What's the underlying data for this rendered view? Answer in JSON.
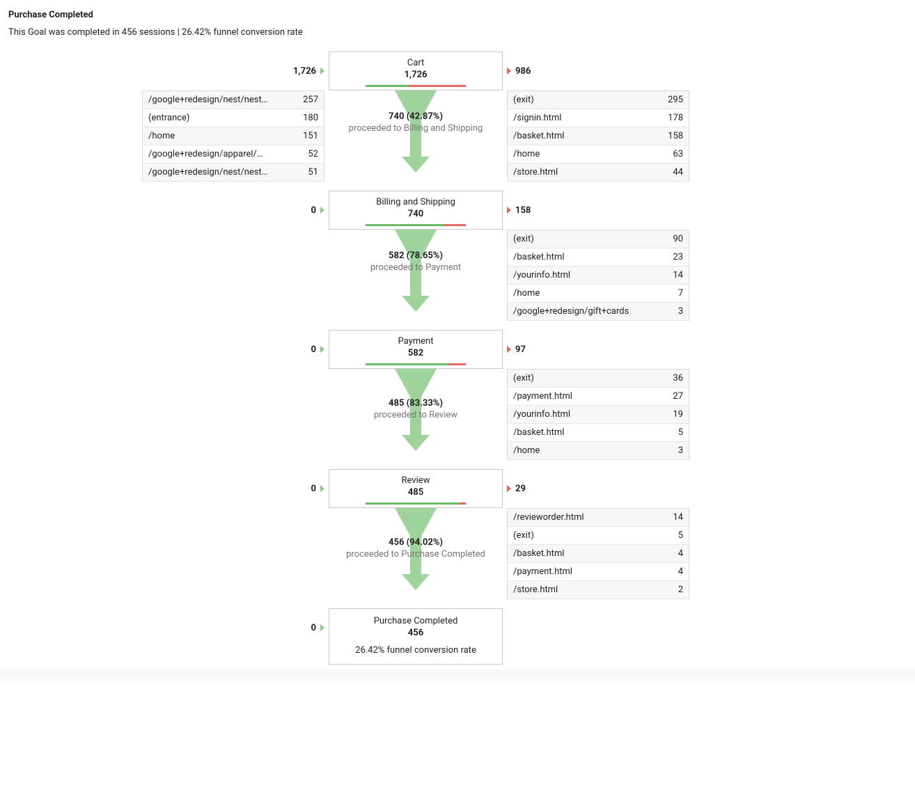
{
  "header": {
    "title": "Purchase Completed",
    "subtitle_prefix": "This Goal was completed in ",
    "sessions": "456",
    "sessions_word": " sessions | ",
    "funnel_rate": "26.42%",
    "funnel_rate_suffix": " funnel conversion rate"
  },
  "final_rate_line": "26.42% funnel conversion rate",
  "steps": [
    {
      "name": "Cart",
      "count": "1,726",
      "in_count": "1,726",
      "out_count": "986",
      "proceed_ratio": 0.4287,
      "proceed_stat": "740 (42.87%)",
      "proceed_desc": "proceeded to Billing and Shipping",
      "in_paths": [
        {
          "p": "/google+redesign/nest/nest…",
          "n": "257"
        },
        {
          "p": "(entrance)",
          "n": "180"
        },
        {
          "p": "/home",
          "n": "151"
        },
        {
          "p": "/google+redesign/apparel/…",
          "n": "52"
        },
        {
          "p": "/google+redesign/nest/nest…",
          "n": "51"
        }
      ],
      "out_paths": [
        {
          "p": "(exit)",
          "n": "295"
        },
        {
          "p": "/signin.html",
          "n": "178"
        },
        {
          "p": "/basket.html",
          "n": "158"
        },
        {
          "p": "/home",
          "n": "63"
        },
        {
          "p": "/store.html",
          "n": "44"
        }
      ]
    },
    {
      "name": "Billing and Shipping",
      "count": "740",
      "in_count": "0",
      "out_count": "158",
      "proceed_ratio": 0.7865,
      "proceed_stat": "582 (78.65%)",
      "proceed_desc": "proceeded to Payment",
      "in_paths": [],
      "out_paths": [
        {
          "p": "(exit)",
          "n": "90"
        },
        {
          "p": "/basket.html",
          "n": "23"
        },
        {
          "p": "/yourinfo.html",
          "n": "14"
        },
        {
          "p": "/home",
          "n": "7"
        },
        {
          "p": "/google+redesign/gift+cards",
          "n": "3"
        }
      ]
    },
    {
      "name": "Payment",
      "count": "582",
      "in_count": "0",
      "out_count": "97",
      "proceed_ratio": 0.8333,
      "proceed_stat": "485 (83.33%)",
      "proceed_desc": "proceeded to Review",
      "in_paths": [],
      "out_paths": [
        {
          "p": "(exit)",
          "n": "36"
        },
        {
          "p": "/payment.html",
          "n": "27"
        },
        {
          "p": "/yourinfo.html",
          "n": "19"
        },
        {
          "p": "/basket.html",
          "n": "5"
        },
        {
          "p": "/home",
          "n": "3"
        }
      ]
    },
    {
      "name": "Review",
      "count": "485",
      "in_count": "0",
      "out_count": "29",
      "proceed_ratio": 0.9402,
      "proceed_stat": "456 (94.02%)",
      "proceed_desc": "proceeded to Purchase Completed",
      "in_paths": [],
      "out_paths": [
        {
          "p": "/revieworder.html",
          "n": "14"
        },
        {
          "p": "(exit)",
          "n": "5"
        },
        {
          "p": "/basket.html",
          "n": "4"
        },
        {
          "p": "/payment.html",
          "n": "4"
        },
        {
          "p": "/store.html",
          "n": "2"
        }
      ]
    },
    {
      "name": "Purchase Completed",
      "count": "456",
      "in_count": "0",
      "out_count": "",
      "proceed_ratio": null,
      "proceed_stat": "",
      "proceed_desc": "",
      "in_paths": [],
      "out_paths": [],
      "final": true
    }
  ]
}
